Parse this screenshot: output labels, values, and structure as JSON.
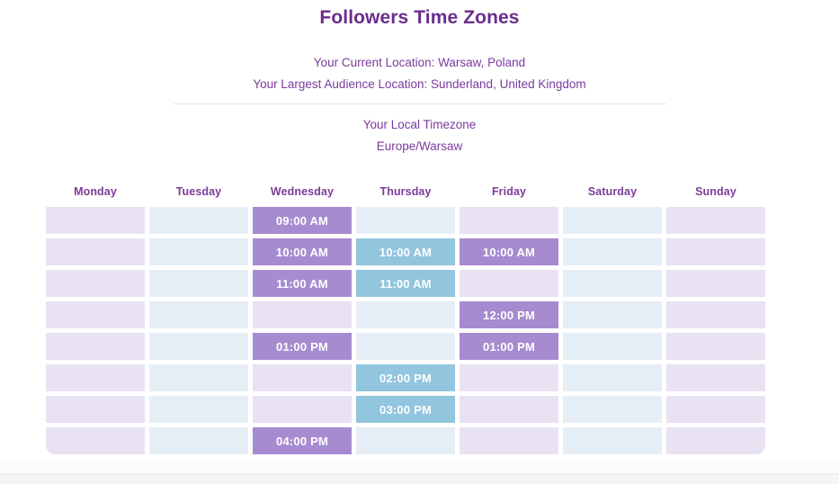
{
  "header": {
    "title": "Followers Time Zones",
    "current_location_line": "Your Current Location: Warsaw, Poland",
    "largest_audience_line": "Your Largest Audience Location: Sunderland, United Kingdom",
    "local_timezone_label": "Your Local Timezone",
    "local_timezone_value": "Europe/Warsaw"
  },
  "colors": {
    "title_purple": "#6b2d8c",
    "text_purple": "#7b3a9e",
    "header_purple": "#7d3c98",
    "empty_lavender": "#e8e2f3",
    "empty_blue": "#e6eef5",
    "filled_purple": "#a78bd0",
    "filled_blue": "#92c5de",
    "filled_text": "#ffffff",
    "divider": "#e4e4e6"
  },
  "grid": {
    "row_count": 8,
    "days": [
      "Monday",
      "Tuesday",
      "Wednesday",
      "Thursday",
      "Friday",
      "Saturday",
      "Sunday"
    ],
    "cells": [
      [
        "",
        "",
        "09:00 AM",
        "",
        "",
        "",
        ""
      ],
      [
        "",
        "",
        "10:00 AM",
        "10:00 AM",
        "10:00 AM",
        "",
        ""
      ],
      [
        "",
        "",
        "11:00 AM",
        "11:00 AM",
        "",
        "",
        ""
      ],
      [
        "",
        "",
        "",
        "",
        "12:00 PM",
        "",
        ""
      ],
      [
        "",
        "",
        "01:00 PM",
        "",
        "01:00 PM",
        "",
        ""
      ],
      [
        "",
        "",
        "",
        "02:00 PM",
        "",
        "",
        ""
      ],
      [
        "",
        "",
        "",
        "03:00 PM",
        "",
        "",
        ""
      ],
      [
        "",
        "",
        "04:00 PM",
        "",
        "",
        "",
        ""
      ]
    ]
  }
}
